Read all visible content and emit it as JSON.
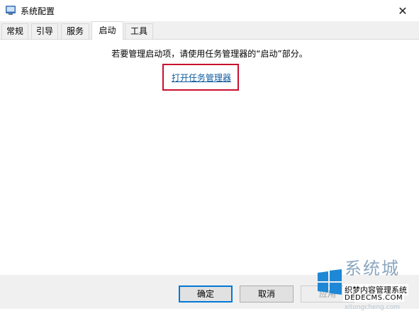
{
  "window": {
    "title": "系统配置",
    "icon": "msconfig-icon",
    "close_glyph": "✕"
  },
  "tabs": [
    {
      "label": "常规",
      "active": false
    },
    {
      "label": "引导",
      "active": false
    },
    {
      "label": "服务",
      "active": false
    },
    {
      "label": "启动",
      "active": true
    },
    {
      "label": "工具",
      "active": false
    }
  ],
  "startup_panel": {
    "info_text": "若要管理启动项，请使用任务管理器的“启动”部分。",
    "open_task_manager_link": "打开任务管理器"
  },
  "footer": {
    "ok_label": "确定",
    "cancel_label": "取消",
    "apply_label": "应用",
    "apply_disabled": true
  },
  "watermark": {
    "big_text": "系统城",
    "line1": "织梦内容管理系统",
    "line2": "DEDECMS.COM",
    "site": "xitongcheng.com"
  },
  "colors": {
    "link": "#0f5b9e",
    "highlight": "#c8102e",
    "default_button_border": "#0078d7"
  }
}
